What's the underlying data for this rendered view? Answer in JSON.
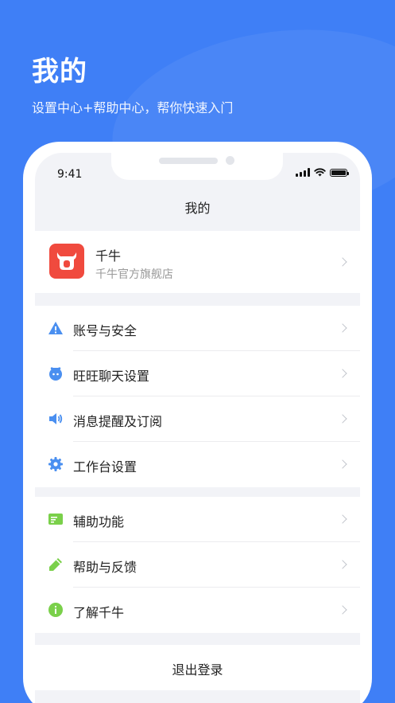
{
  "header": {
    "title": "我的",
    "subtitle": "设置中心+帮助中心，帮你快速入门"
  },
  "status_bar": {
    "time": "9:41",
    "icons": [
      "signal-icon",
      "wifi-icon",
      "battery-icon"
    ]
  },
  "nav": {
    "title": "我的"
  },
  "profile": {
    "name": "千牛",
    "subtitle": "千牛官方旗舰店",
    "icon": "qianniu-logo"
  },
  "menu_groups": [
    {
      "items": [
        {
          "label": "账号与安全",
          "icon": "warning-triangle-icon",
          "color": "#4a8ff0"
        },
        {
          "label": "旺旺聊天设置",
          "icon": "wangwang-chat-icon",
          "color": "#4a8ff0"
        },
        {
          "label": "消息提醒及订阅",
          "icon": "speaker-icon",
          "color": "#4a8ff0"
        },
        {
          "label": "工作台设置",
          "icon": "gear-icon",
          "color": "#4a8ff0"
        }
      ]
    },
    {
      "items": [
        {
          "label": "辅助功能",
          "icon": "card-icon",
          "color": "#7ad04a"
        },
        {
          "label": "帮助与反馈",
          "icon": "pencil-icon",
          "color": "#7ad04a"
        },
        {
          "label": "了解千牛",
          "icon": "info-icon",
          "color": "#7ad04a"
        }
      ]
    }
  ],
  "logout_label": "退出登录",
  "colors": {
    "background": "#3f7ff6",
    "brand_red": "#f04a3e",
    "blue_icon": "#4a8ff0",
    "green_icon": "#7ad04a"
  }
}
